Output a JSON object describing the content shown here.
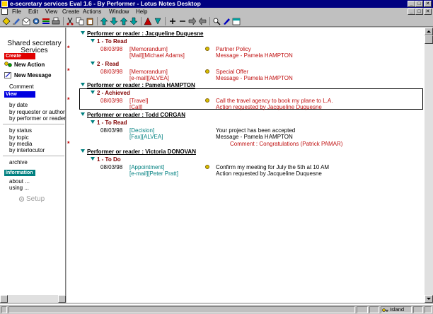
{
  "window": {
    "title": "e-secretary services Eval 1.6 - By Performer - Lotus Notes Desktop",
    "min_glyph": "_",
    "max_glyph": "□",
    "close_glyph": "✕"
  },
  "menu": [
    "File",
    "Edit",
    "View",
    "Create",
    "Actions",
    "Window",
    "Help"
  ],
  "nav": {
    "title": "Shared secretary",
    "subtitle": "Services",
    "create_label": "Create",
    "new_action": "New Action",
    "new_message": "New Message",
    "comment": "Comment",
    "view_label": "View",
    "view_items": [
      "by date",
      "by requester or author",
      "by performer or reader",
      "by status",
      "by topic",
      "by media",
      "by interlocutor",
      "archive"
    ],
    "info_label": "Information",
    "info_items": [
      "about ...",
      "using ..."
    ],
    "setup": "Setup"
  },
  "colors": {
    "create_header": "#e00000",
    "view_header": "#0000e0",
    "info_header": "#008080"
  },
  "groups": [
    {
      "head": "Performer or reader : Jacqueline Duquesne",
      "subs": [
        {
          "head": "1 - To Read",
          "entries": [
            {
              "date": "08/03/98",
              "type": "[Memorandum]",
              "type2": "[Mail][Michael Adams]",
              "subject": "Partner Policy",
              "subject2": "Message - Pamela HAMPTON",
              "star": true,
              "dot": true
            }
          ]
        },
        {
          "head": "2 - Read",
          "entries": [
            {
              "date": "08/03/98",
              "type": "[Memorandum]",
              "type2": "[e-mail][ALVEA]",
              "subject": "Special Offer",
              "subject2": "Message - Pamela HAMPTON",
              "star": true,
              "dot": true
            }
          ]
        }
      ]
    },
    {
      "head": "Performer or reader : Pamela HAMPTON",
      "subs": [
        {
          "head": "2 - Achieved",
          "entries": [
            {
              "date": "08/03/98",
              "type": "[Travel]",
              "type2": "[Call]",
              "subject": "Call the travel agency to book my plane to L.A.",
              "subject2": "Action requested by Jacqueline Duquesne",
              "star": true,
              "dot": true
            }
          ]
        }
      ]
    },
    {
      "head": "Performer or reader : Todd CORGAN",
      "subs": [
        {
          "head": "1 - To Read",
          "entries": [
            {
              "date": "08/03/98",
              "type": "[Decision]",
              "type2": "[Fax][ALVEA]",
              "subject": "Your project has been accepted",
              "subject2": "Message - Pamela HAMPTON",
              "comment": "Comment : Congratulations (Patrick PAMAR)",
              "star": true,
              "dot": false
            }
          ]
        }
      ]
    },
    {
      "head": "Performer or reader : Victoria DONOVAN",
      "subs": [
        {
          "head": "1 - To Do",
          "entries": [
            {
              "date": "08/03/98",
              "type": "[Appointment]",
              "type2": "[e-mail][Peter Pratt]",
              "subject": "Confirm my meeting for July the 5th at 10 AM",
              "subject2": "Action requested by Jacqueline Duquesne",
              "star": false,
              "dot": true
            }
          ]
        }
      ]
    }
  ],
  "status": {
    "location": "Island"
  }
}
